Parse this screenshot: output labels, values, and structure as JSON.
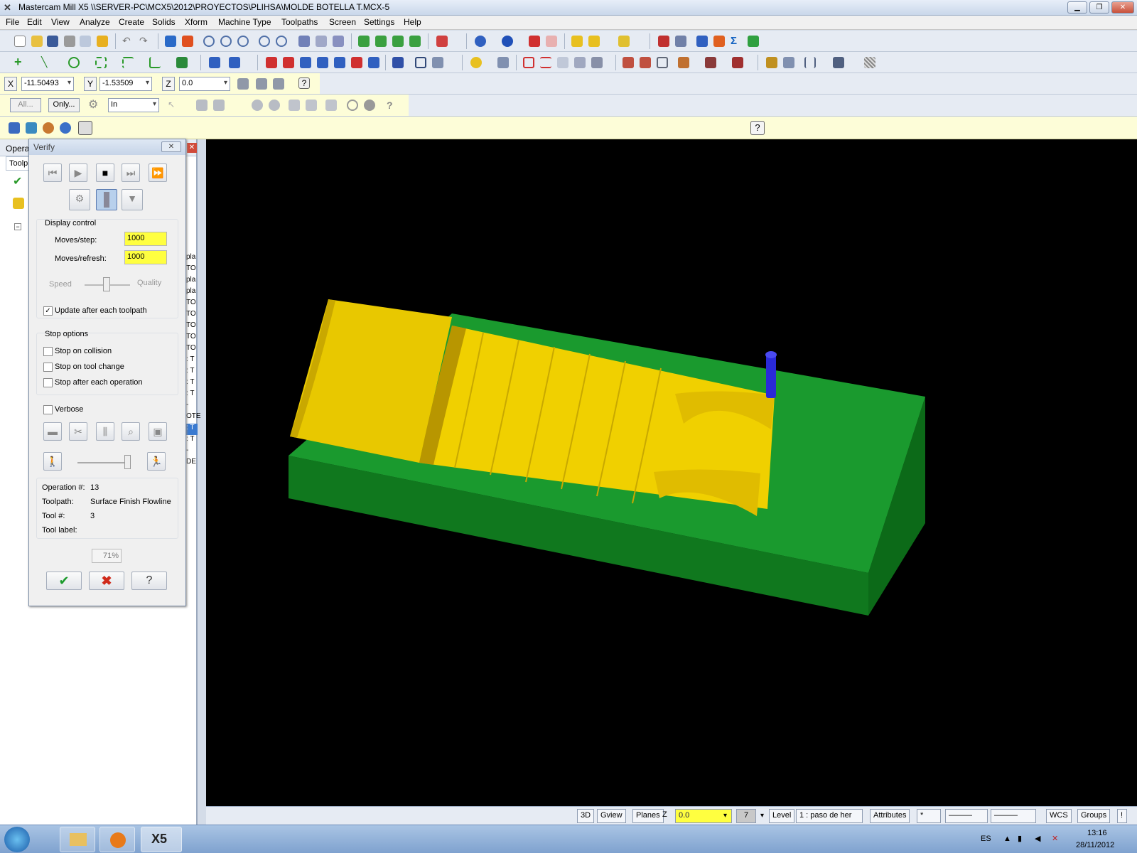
{
  "window": {
    "title": "Mastercam Mill X5  \\\\SERVER-PC\\MCX5\\2012\\PROYECTOS\\PLIHSA\\MOLDE BOTELLA T.MCX-5"
  },
  "menu": [
    "File",
    "Edit",
    "View",
    "Analyze",
    "Create",
    "Solids",
    "Xform",
    "Machine Type",
    "Toolpaths",
    "Screen",
    "Settings",
    "Help"
  ],
  "coords": {
    "x_label": "X",
    "x_value": "-11.50493",
    "y_label": "Y",
    "y_value": "-1.53509",
    "z_label": "Z",
    "z_value": "0.0"
  },
  "selection": {
    "all_label": "All...",
    "only_label": "Only...",
    "mode_value": "In"
  },
  "ops_panel": {
    "tab_title": "Opera",
    "tab_toolpaths": "Toolp",
    "side_labels": [
      "pla",
      "TO",
      "pla",
      "pla",
      "TO",
      "TO",
      "TO",
      "TO",
      "TO",
      ": T",
      ": T",
      ": T",
      ": T",
      "-",
      "OTE",
      ": T",
      ": T",
      "-",
      "DE"
    ]
  },
  "verify": {
    "title": "Verify",
    "display_control": "Display control",
    "moves_step_label": "Moves/step:",
    "moves_step_value": "1000",
    "moves_refresh_label": "Moves/refresh:",
    "moves_refresh_value": "1000",
    "speed_label": "Speed",
    "quality_label": "Quality",
    "update_label": "Update after each toolpath",
    "update_checked": true,
    "stop_options": "Stop options",
    "stop_collision": "Stop on collision",
    "stop_tool_change": "Stop on tool change",
    "stop_each_op": "Stop after each operation",
    "verbose": "Verbose",
    "operation_label": "Operation #:",
    "operation_value": "13",
    "toolpath_label": "Toolpath:",
    "toolpath_value": "Surface Finish Flowline",
    "tool_num_label": "Tool #:",
    "tool_num_value": "3",
    "tool_label_label": "Tool label:",
    "progress": "71%"
  },
  "statusbar": {
    "three_d": "3D",
    "gview": "Gview",
    "planes": "Planes",
    "z_label": "Z",
    "z_value": "0.0",
    "level_num": "7",
    "level_label": "Level",
    "level_value": "1 : paso de her",
    "attributes": "Attributes",
    "wcs": "WCS",
    "groups": "Groups"
  },
  "taskbar": {
    "lang": "ES",
    "time": "13:16",
    "date": "28/11/2012"
  },
  "colors": {
    "stock_green": "#1a9a2e",
    "part_yellow": "#f0d000",
    "tool_blue": "#2a2ad8",
    "viewport_bg": "#000000",
    "highlight_yellow": "#ffff40"
  }
}
